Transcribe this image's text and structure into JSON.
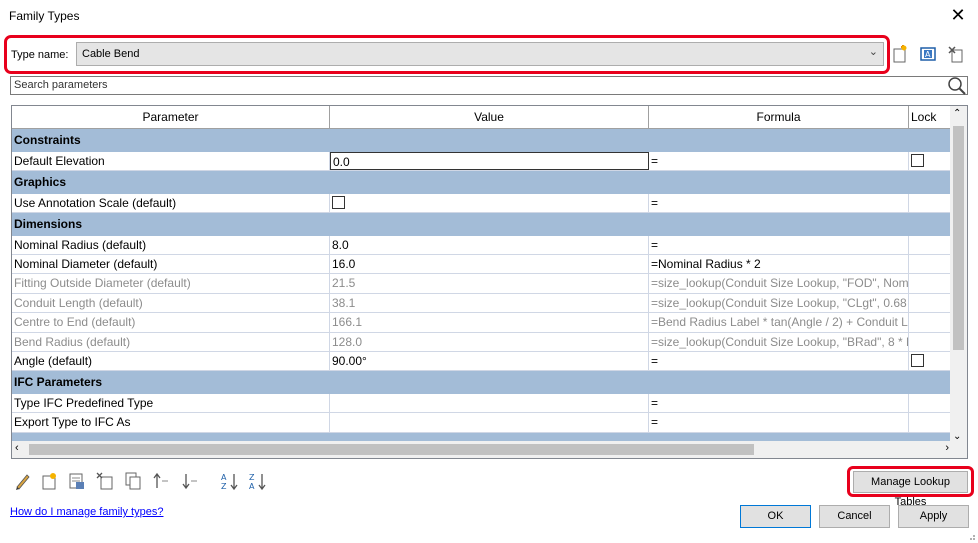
{
  "window": {
    "title": "Family Types",
    "close_glyph": "✕"
  },
  "type_name": {
    "label": "Type name:",
    "value": "Cable Bend"
  },
  "search": {
    "placeholder": "Search parameters"
  },
  "columns": [
    "Parameter",
    "Value",
    "Formula",
    "Lock"
  ],
  "rows": [
    {
      "kind": "group",
      "param": "Constraints"
    },
    {
      "kind": "row",
      "param": "Default Elevation",
      "value": "0.0",
      "formula": "=",
      "lock": true,
      "value_editing": true
    },
    {
      "kind": "group",
      "param": "Graphics"
    },
    {
      "kind": "row",
      "param": "Use Annotation Scale (default)",
      "value_checkbox": true,
      "formula": "="
    },
    {
      "kind": "group",
      "param": "Dimensions"
    },
    {
      "kind": "row",
      "param": "Nominal Radius (default)",
      "value": "8.0",
      "formula": "="
    },
    {
      "kind": "row",
      "param": "Nominal Diameter (default)",
      "value": "16.0",
      "formula": "=Nominal Radius * 2"
    },
    {
      "kind": "row",
      "dim": true,
      "param": "Fitting Outside Diameter (default)",
      "value": "21.5",
      "formula": "=size_lookup(Conduit Size Lookup, \"FOD\", Nomi"
    },
    {
      "kind": "row",
      "dim": true,
      "param": "Conduit Length (default)",
      "value": "38.1",
      "formula": "=size_lookup(Conduit Size Lookup, \"CLgt\", 0.68 *"
    },
    {
      "kind": "row",
      "dim": true,
      "param": "Centre to End (default)",
      "value": "166.1",
      "formula": "=Bend Radius Label * tan(Angle / 2) + Conduit L"
    },
    {
      "kind": "row",
      "dim": true,
      "param": "Bend Radius (default)",
      "value": "128.0",
      "formula": "=size_lookup(Conduit Size Lookup, \"BRad\", 8 * N"
    },
    {
      "kind": "row",
      "param": "Angle (default)",
      "value": "90.00°",
      "formula": "=",
      "lock": true
    },
    {
      "kind": "group",
      "param": "IFC Parameters"
    },
    {
      "kind": "row",
      "param": "Type IFC Predefined Type",
      "value": "",
      "formula": "="
    },
    {
      "kind": "row",
      "param": "Export Type to IFC As",
      "value": "",
      "formula": "="
    },
    {
      "kind": "group",
      "param": ""
    }
  ],
  "buttons": {
    "manage_lookup": "Manage Lookup Tables",
    "ok": "OK",
    "cancel": "Cancel",
    "apply": "Apply"
  },
  "help_link": "How do I manage family types?",
  "colors": {
    "highlight": "#e8001c",
    "group_bg": "#a3bcd7",
    "link": "#0000ff"
  },
  "icons": {
    "toolbar_top": [
      "new-type-icon",
      "rename-type-icon",
      "delete-type-icon"
    ],
    "toolbar_bottom": [
      "edit-parameter-icon",
      "new-parameter-icon",
      "delete-parameter-icon",
      "new-shared-parameter-icon",
      "copy-parameter-icon",
      "move-up-icon",
      "move-down-icon",
      "sort-ascending-icon",
      "sort-descending-icon"
    ]
  }
}
